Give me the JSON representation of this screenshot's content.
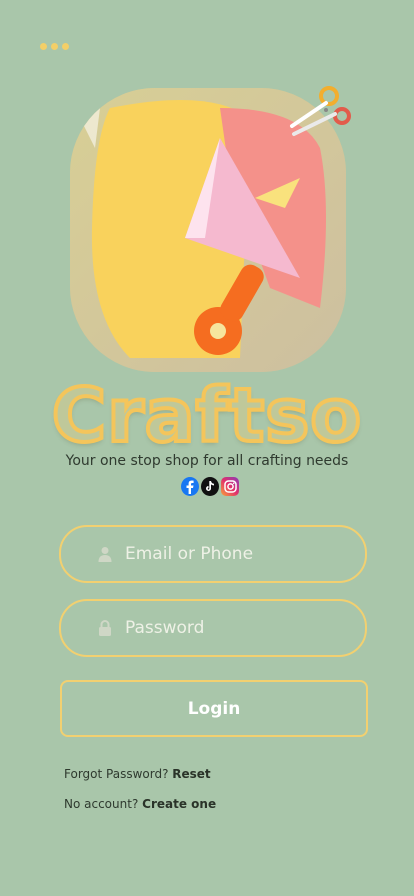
{
  "app": {
    "logo_text": "Craftso",
    "tagline": "Your one stop shop for all crafting needs"
  },
  "social": [
    "facebook-icon",
    "tiktok-icon",
    "instagram-icon"
  ],
  "form": {
    "email_placeholder": "Email or Phone",
    "password_placeholder": "Password",
    "login_label": "Login"
  },
  "links": {
    "forgot_text": "Forgot Password?",
    "reset_label": "Reset",
    "no_account_text": "No account?",
    "create_label": "Create one"
  },
  "colors": {
    "background": "#a9c6aa",
    "accent": "#f2d070"
  }
}
